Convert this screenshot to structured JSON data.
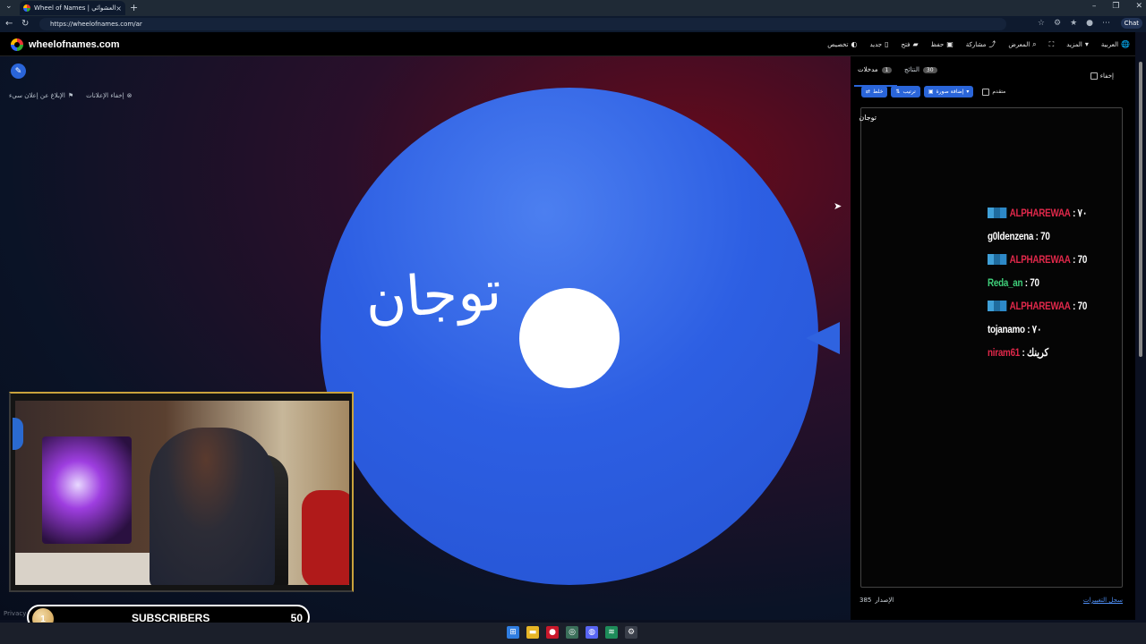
{
  "browser": {
    "tab_title": "Wheel of Names | الاسم العشوائي",
    "tab_close": "×",
    "new_tab": "+",
    "url": "https://wheelofnames.com/ar",
    "chat_label": "Chat"
  },
  "header": {
    "logo_text": "wheelofnames.com",
    "menu": [
      {
        "label": "العربية",
        "icon": "globe-icon"
      },
      {
        "label": "المزيد",
        "icon": "chevron-down-icon"
      },
      {
        "label": "",
        "icon": "fullscreen-icon"
      },
      {
        "label": "المعرض",
        "icon": "search-icon"
      },
      {
        "label": "مشاركة",
        "icon": "share-icon"
      },
      {
        "label": "حفظ",
        "icon": "save-icon"
      },
      {
        "label": "فتح",
        "icon": "folder-icon"
      },
      {
        "label": "جديد",
        "icon": "file-icon"
      },
      {
        "label": "تخصيص",
        "icon": "palette-icon"
      }
    ]
  },
  "left": {
    "report_ad": "الإبلاغ عن إعلان سيء",
    "hide_ads": "إخفاء الإعلانات"
  },
  "wheel": {
    "segment_text": "توجان",
    "color": "#2d5fe3"
  },
  "panel": {
    "tab_entries_label": "مدخلات",
    "tab_entries_count": "1",
    "tab_results_label": "النتائج",
    "tab_results_count": "30",
    "hide_label": "إخفاء",
    "shuffle_label": "خلط",
    "sort_label": "ترتيب",
    "add_image_label": "إضافة صورة",
    "advanced_label": "متقدم",
    "entry_text": "توجان",
    "version_label": "الإصدار",
    "version_number": "385",
    "changelog_link": "سجل التغييرات"
  },
  "chat": [
    {
      "user": "ALPHAREWAA",
      "color": "#e0284a",
      "badge": true,
      "msg": "٧٠"
    },
    {
      "user": "g0ldenzena",
      "color": "#ffffff",
      "badge": false,
      "msg": "70"
    },
    {
      "user": "ALPHAREWAA",
      "color": "#e0284a",
      "badge": true,
      "msg": "70"
    },
    {
      "user": "Reda_an",
      "color": "#3fcf7a",
      "badge": false,
      "msg": "70"
    },
    {
      "user": "ALPHAREWAA",
      "color": "#e0284a",
      "badge": true,
      "msg": "70"
    },
    {
      "user": "tojanamo",
      "color": "#ffffff",
      "badge": false,
      "msg": "٧٠"
    },
    {
      "user": "niram61",
      "color": "#e0284a",
      "badge": false,
      "msg": "كرينك"
    }
  ],
  "overlay": {
    "subscribers_current": "1",
    "subscribers_label": "SUBSCRIBERS",
    "subscribers_goal": "50",
    "privacy_text": "Privacy"
  }
}
